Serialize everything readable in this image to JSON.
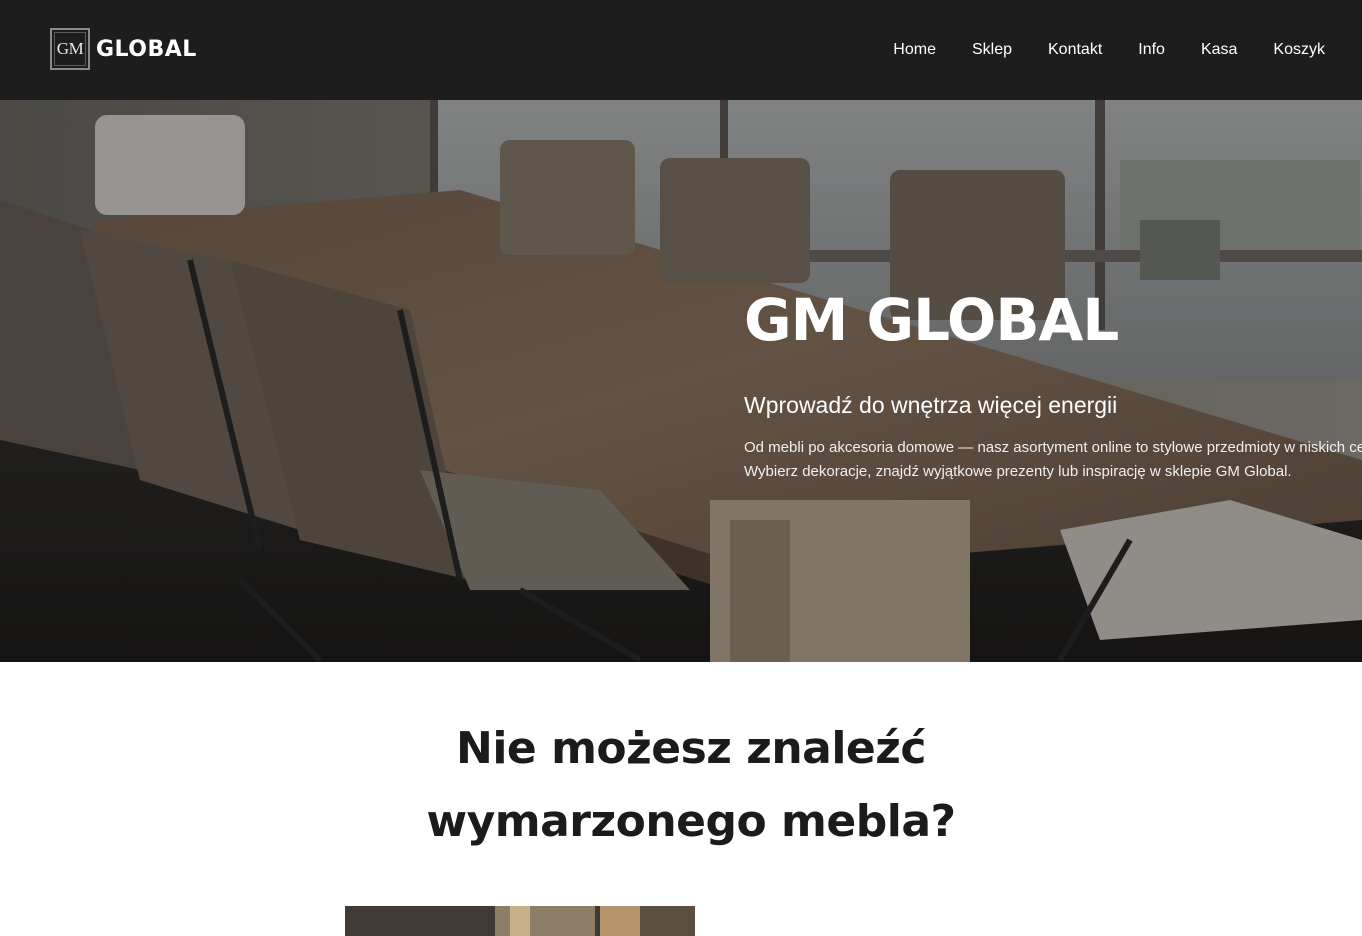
{
  "header": {
    "logo_mark": "GM",
    "logo_text": "GLOBAL",
    "nav": [
      {
        "label": "Home"
      },
      {
        "label": "Sklep"
      },
      {
        "label": "Kontakt"
      },
      {
        "label": "Info"
      },
      {
        "label": "Kasa"
      },
      {
        "label": "Koszyk"
      }
    ]
  },
  "hero": {
    "title": "GM GLOBAL",
    "subtitle": "Wprowadź do wnętrza więcej energii",
    "text": "Od mebli po akcesoria domowe — nasz asortyment online to stylowe przedmioty w niskich cenach. Wybierz dekoracje, znajdź wyjątkowe prezenty lub inspirację w sklepie GM Global."
  },
  "section": {
    "heading": "Nie możesz znaleźć wymarzonego mebla?"
  },
  "colors": {
    "header_bg": "#1d1d1d",
    "text_dark": "#1b1b1b",
    "white": "#ffffff"
  }
}
